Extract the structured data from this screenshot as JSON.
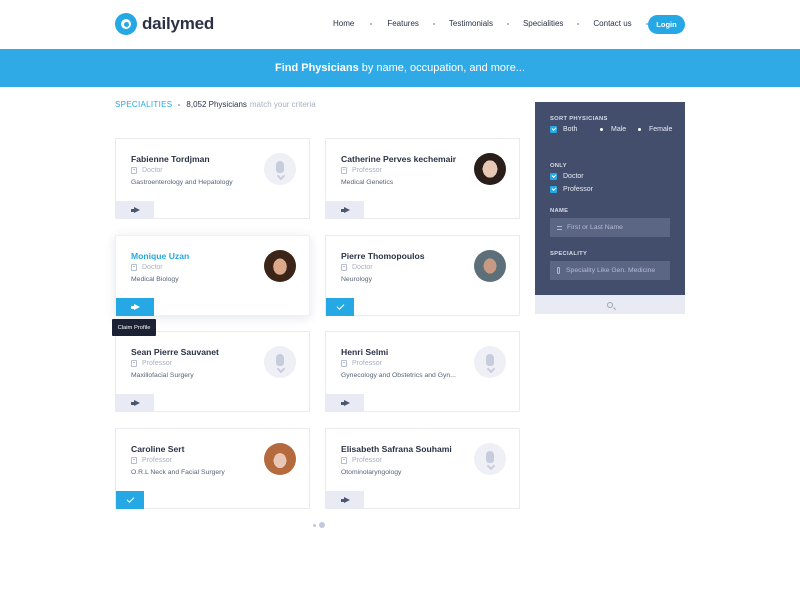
{
  "brand": {
    "name": "dailymed"
  },
  "nav": {
    "items": [
      "Home",
      "Features",
      "Testimonials",
      "Specialities",
      "Contact us"
    ],
    "login": "Login"
  },
  "banner": {
    "bold": "Find Physicians",
    "rest": "by name, occupation, and more..."
  },
  "results": {
    "label": "Specialities",
    "count": "8,052 Physicians",
    "suffix": "match your criteria"
  },
  "cards": [
    {
      "name": "Fabienne Tordjman",
      "role": "Doctor",
      "speciality": "Gastroenterology and Hepatology",
      "avatar": "placeholder",
      "action": "claim",
      "active": false
    },
    {
      "name": "Catherine Perves kechemair",
      "role": "Professor",
      "speciality": "Medical Genetics",
      "avatar": "photo",
      "action": "claim",
      "active": false
    },
    {
      "name": "Monique Uzan",
      "role": "Doctor",
      "speciality": "Medical Biology",
      "avatar": "photo",
      "action": "claim",
      "active": true
    },
    {
      "name": "Pierre Thomopoulos",
      "role": "Doctor",
      "speciality": "Neurology",
      "avatar": "photo",
      "action": "verified",
      "active": false
    },
    {
      "name": "Sean Pierre Sauvanet",
      "role": "Professor",
      "speciality": "Maxillofacial Surgery",
      "avatar": "placeholder",
      "action": "claim",
      "active": false
    },
    {
      "name": "Henri Selmi",
      "role": "Professor",
      "speciality": "Gynecology and Obstetrics and Gyn...",
      "avatar": "placeholder",
      "action": "claim",
      "active": false
    },
    {
      "name": "Caroline Sert",
      "role": "Professor",
      "speciality": "O.R.L Neck and Facial Surgery",
      "avatar": "photo",
      "action": "verified",
      "active": false
    },
    {
      "name": "Elisabeth Safrana Souhami",
      "role": "Professor",
      "speciality": "Otominolaryngology",
      "avatar": "placeholder",
      "action": "claim",
      "active": false
    }
  ],
  "tooltip": "Claim Profile",
  "filters": {
    "sort_title": "Sort Physicians",
    "sort_options": [
      "Both",
      "Male",
      "Female"
    ],
    "only_title": "Only",
    "only_options": [
      "Doctor",
      "Professor"
    ],
    "name_title": "Name",
    "name_placeholder": "First or Last Name",
    "spec_title": "Speciality",
    "spec_placeholder": "Speciality Like Gen. Medicine"
  },
  "colors": {
    "accent": "#25a8e3",
    "panel": "#434e6c",
    "banner": "#2faae6"
  }
}
